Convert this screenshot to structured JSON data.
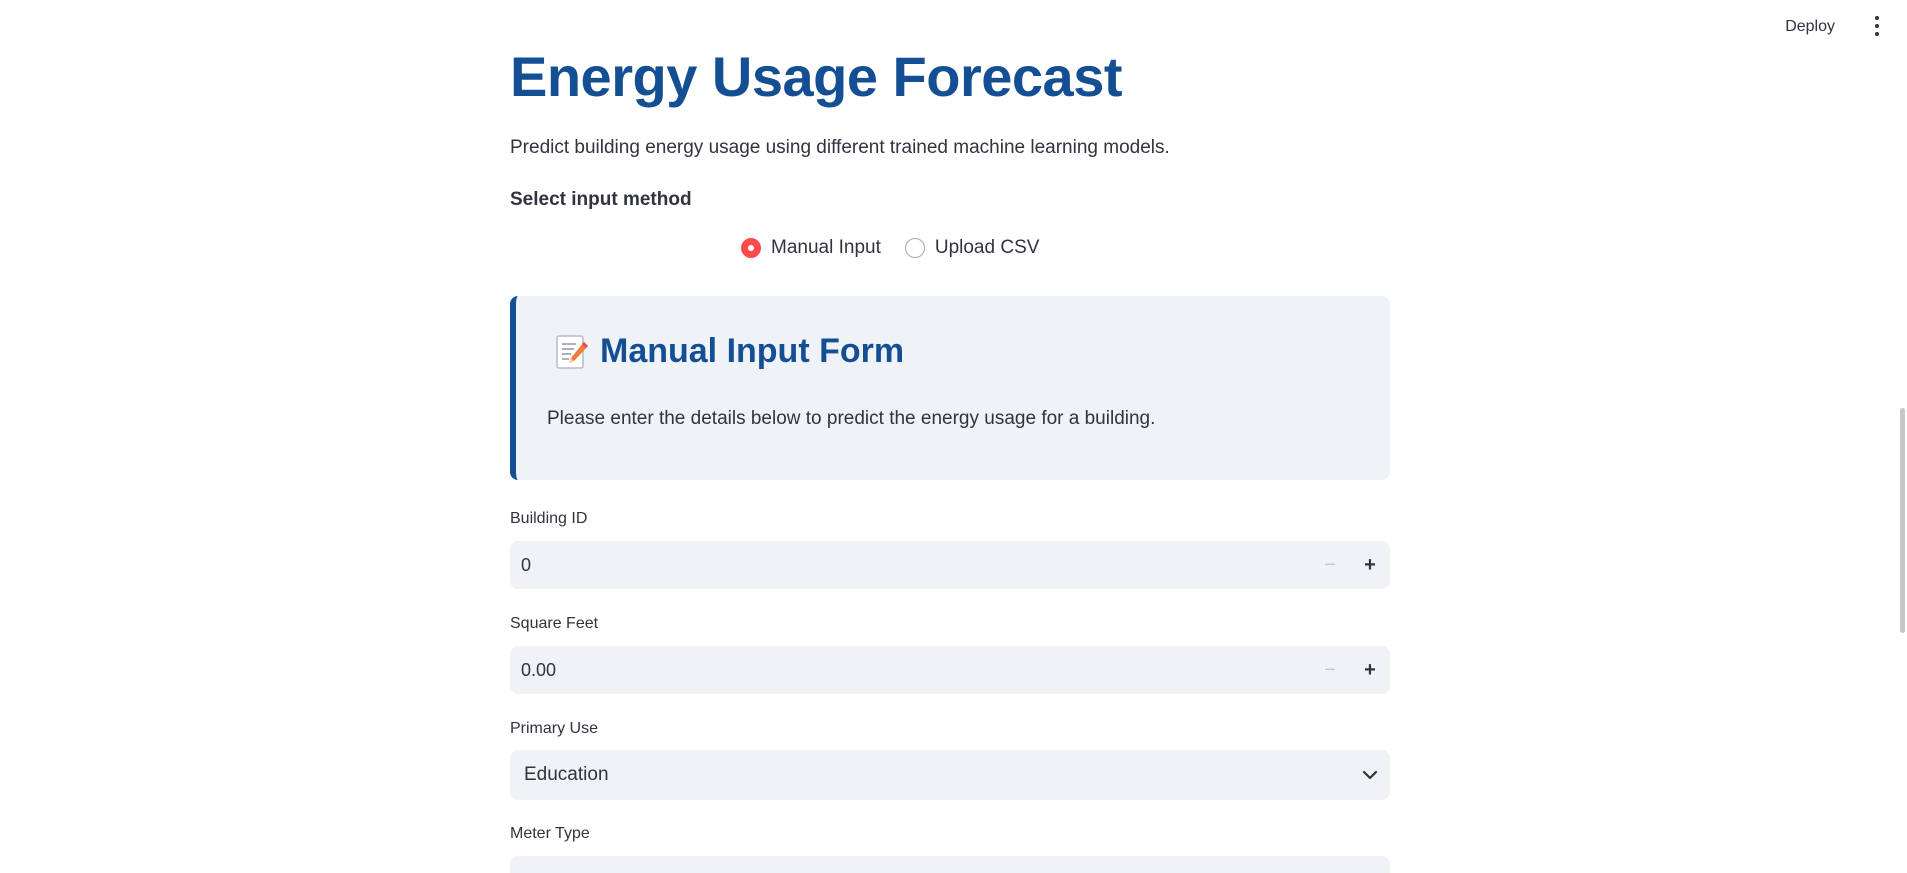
{
  "header": {
    "deploy_label": "Deploy",
    "menu_icon": "more-vertical-icon"
  },
  "main": {
    "title": "Energy Usage Forecast",
    "subtitle": "Predict building energy usage using different trained machine learning models.",
    "input_method": {
      "label": "Select input method",
      "options": [
        {
          "label": "Manual Input",
          "selected": true
        },
        {
          "label": "Upload CSV",
          "selected": false
        }
      ]
    },
    "info_card": {
      "icon": "memo-icon",
      "heading": "Manual Input Form",
      "text": "Please enter the details below to predict the energy usage for a building.",
      "accent_color": "#144f94"
    },
    "fields": {
      "building_id": {
        "label": "Building ID",
        "value": "0"
      },
      "square_feet": {
        "label": "Square Feet",
        "value": "0.00"
      },
      "primary_use": {
        "label": "Primary Use",
        "value": "Education"
      },
      "meter_type": {
        "label": "Meter Type"
      }
    }
  },
  "colors": {
    "title": "#144f94",
    "radio_selected": "#ff4b4b",
    "input_background": "#f0f2f6",
    "card_background": "#eff2f6"
  }
}
